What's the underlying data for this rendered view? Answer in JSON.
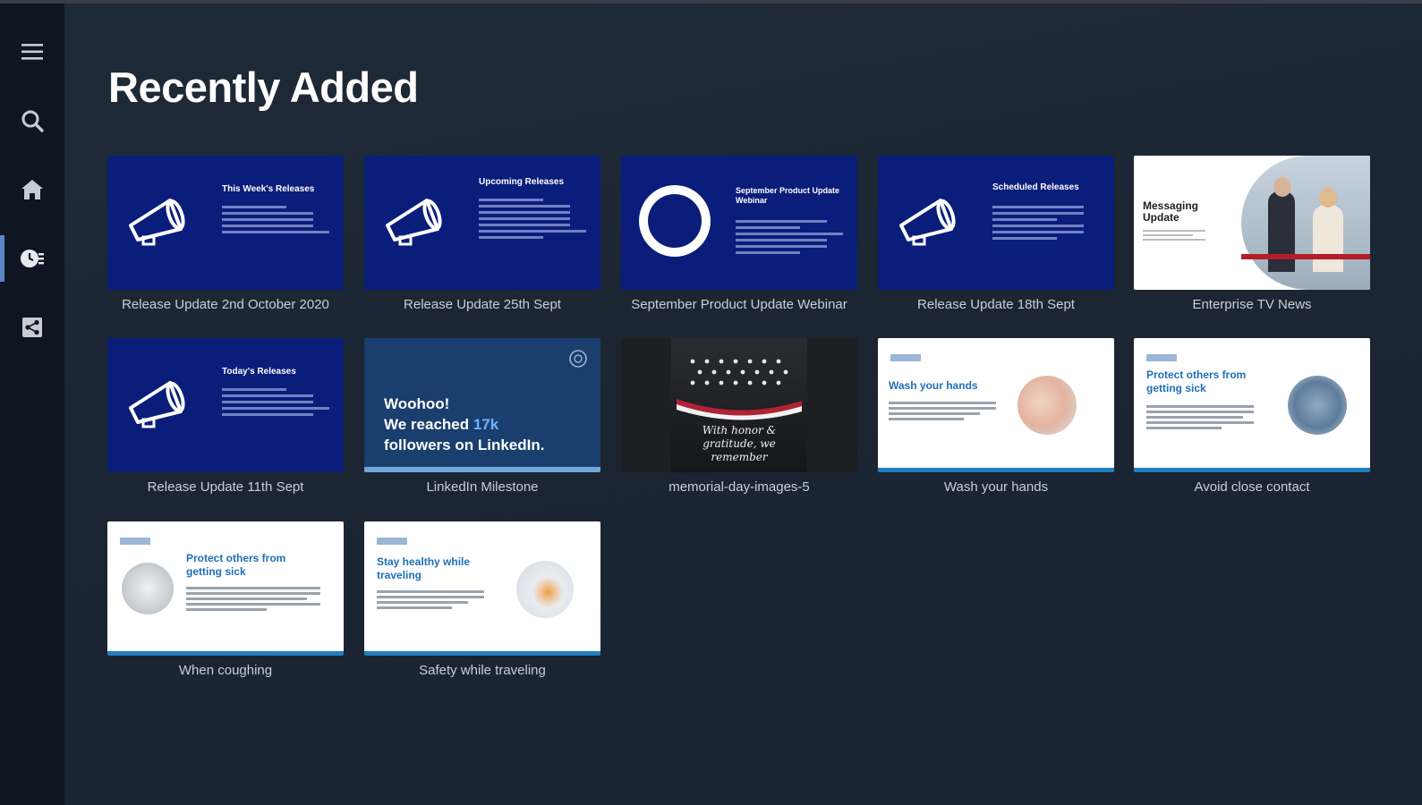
{
  "page": {
    "title": "Recently Added"
  },
  "sidebar": {
    "items": [
      {
        "name": "menu",
        "icon": "hamburger-menu-icon",
        "active": false
      },
      {
        "name": "search",
        "icon": "search-icon",
        "active": false
      },
      {
        "name": "home",
        "icon": "home-icon",
        "active": false
      },
      {
        "name": "recent",
        "icon": "recent-icon",
        "active": true
      },
      {
        "name": "share",
        "icon": "share-icon",
        "active": false
      }
    ],
    "accent_color": "#5b88c4"
  },
  "tiles": [
    {
      "caption": "Release Update 2nd October 2020",
      "slide_title": "This Week's Releases"
    },
    {
      "caption": "Release Update 25th Sept",
      "slide_title": "Upcoming Releases"
    },
    {
      "caption": "September Product Update Webinar",
      "slide_title": "September Product Update Webinar"
    },
    {
      "caption": "Release Update 18th Sept",
      "slide_title": "Scheduled Releases"
    },
    {
      "caption": "Enterprise TV News",
      "slide_title": "Messaging Update"
    },
    {
      "caption": "Release Update 11th Sept",
      "slide_title": "Today's Releases"
    },
    {
      "caption": "LinkedIn Milestone",
      "slide_line1": "Woohoo!",
      "slide_line2a": "We reached ",
      "slide_line2b": "17k",
      "slide_line3": "followers on LinkedIn."
    },
    {
      "caption": "memorial-day-images-5",
      "slide_text": "With honor & gratitude, we remember"
    },
    {
      "caption": "Wash your hands",
      "slide_title": "Wash your hands"
    },
    {
      "caption": "Avoid close contact",
      "slide_title": "Protect others from getting sick"
    },
    {
      "caption": "When coughing",
      "slide_title": "Protect others from getting sick"
    },
    {
      "caption": "Safety while traveling",
      "slide_title": "Stay healthy while traveling"
    }
  ]
}
